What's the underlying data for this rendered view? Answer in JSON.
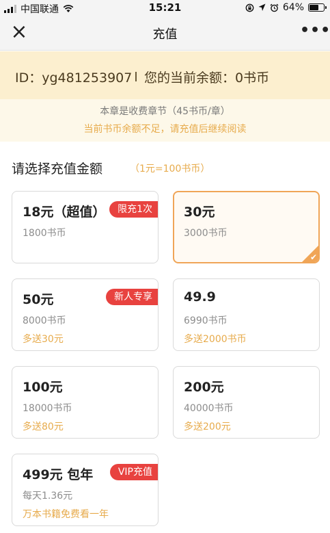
{
  "status_bar": {
    "carrier": "中国联通",
    "time": "15:21",
    "battery_percent": "64%",
    "battery_level": 0.64,
    "icons": [
      "signal-icon",
      "wifi-icon",
      "lock-rotation-icon",
      "location-icon",
      "alarm-icon",
      "battery-icon"
    ]
  },
  "nav": {
    "close_icon": "close-icon",
    "title": "充值",
    "more_icon": "more-icon",
    "close_glyph": "×",
    "more_glyph": "•••"
  },
  "account": {
    "id_text": "ID：yg481253907",
    "balance_text": "您的当前余额：0书币"
  },
  "notice": {
    "line1": "本章是收费章节（45书币/章）",
    "line2": "当前书币余额不足，请充值后继续阅读"
  },
  "section": {
    "title": "请选择充值金额",
    "rate": "（1元=100书币）"
  },
  "options": [
    {
      "price": "18元（超值）",
      "coins": "1800书币",
      "bonus": "",
      "badge": "限充1次",
      "selected": false
    },
    {
      "price": "30元",
      "coins": "3000书币",
      "bonus": "",
      "badge": "",
      "selected": true,
      "check_glyph": "✔"
    },
    {
      "price": "50元",
      "coins": "8000书币",
      "bonus": "多送30元",
      "badge": "新人专享",
      "selected": false
    },
    {
      "price": "49.9",
      "coins": "6990书币",
      "bonus": "多送2000书币",
      "badge": "",
      "selected": false
    },
    {
      "price": "100元",
      "coins": "18000书币",
      "bonus": "多送80元",
      "badge": "",
      "selected": false
    },
    {
      "price": "200元",
      "coins": "40000书币",
      "bonus": "多送200元",
      "badge": "",
      "selected": false
    },
    {
      "price": "499元 包年",
      "coins": "每天1.36元",
      "bonus": "万本书籍免费看一年",
      "badge": "VIP充值",
      "selected": false
    }
  ],
  "colors": {
    "accent": "#f0a557",
    "badge": "#e8423f",
    "bonus_text": "#e7ab4c",
    "id_bar_bg": "#fcefcf",
    "notice_bg": "#fdf8e9"
  }
}
